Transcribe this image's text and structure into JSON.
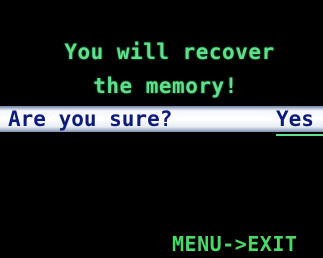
{
  "message": {
    "line1": "You will recover",
    "line2": "the memory!"
  },
  "confirm": {
    "question": "Are you sure?",
    "selected_option": "Yes"
  },
  "footer": {
    "exit_hint": "MENU->EXIT"
  },
  "colors": {
    "text_green": "#5fe08a",
    "bar_text": "#0d1b7a",
    "background": "#000000"
  }
}
